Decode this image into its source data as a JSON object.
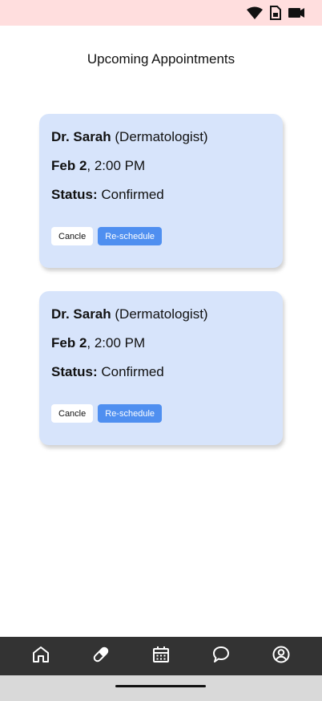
{
  "status_bar": {
    "icons": [
      "wifi-icon",
      "sim-card-icon",
      "battery-icon"
    ],
    "background": "#ffdede"
  },
  "page": {
    "title": "Upcoming Appointments"
  },
  "appointments": [
    {
      "doctor": "Dr. Sarah",
      "specialty": " (Dermatologist)",
      "date": "Feb 2",
      "time": ", 2:00 PM",
      "status_label": "Status:",
      "status": " Confirmed",
      "cancel_label": "Cancle",
      "reschedule_label": "Re-schedule"
    },
    {
      "doctor": "Dr. Sarah",
      "specialty": " (Dermatologist)",
      "date": "Feb 2",
      "time": ", 2:00 PM",
      "status_label": "Status:",
      "status": " Confirmed",
      "cancel_label": "Cancle",
      "reschedule_label": "Re-schedule"
    }
  ],
  "tab_bar": {
    "items": [
      "home-icon",
      "pill-icon",
      "calendar-icon",
      "chat-icon",
      "profile-icon"
    ],
    "background": "#333333"
  },
  "colors": {
    "card": "#d7e4fb",
    "accent": "#4f8ff0"
  }
}
